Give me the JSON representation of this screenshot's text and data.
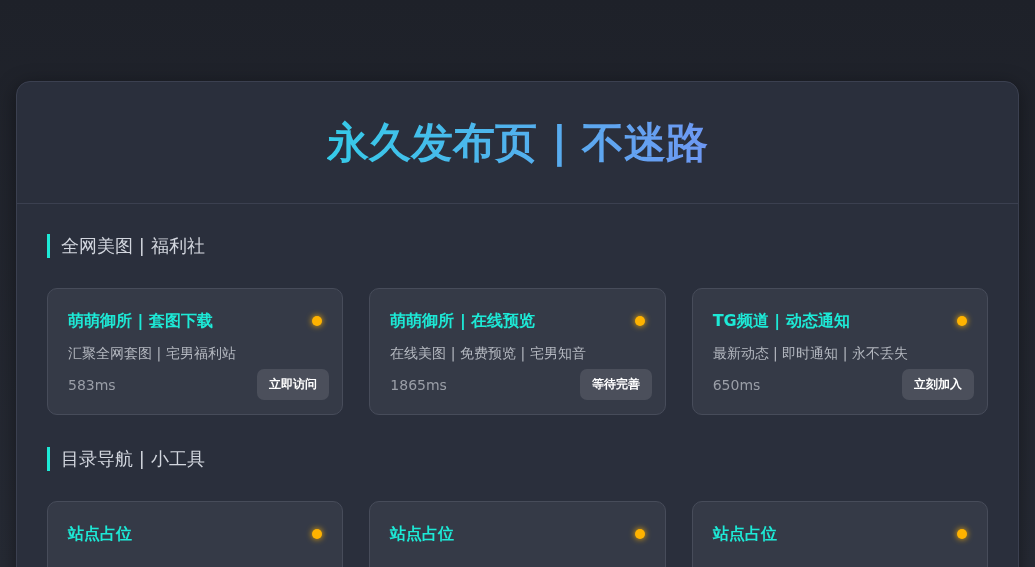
{
  "header": {
    "title": "永久发布页 | 不迷路"
  },
  "sections": [
    {
      "heading": "全网美图 | 福利社",
      "cards": [
        {
          "title": "萌萌御所 | 套图下载",
          "color": "#ffb300",
          "description": "汇聚全网套图 | 宅男福利站",
          "latency": "583ms",
          "button": "立即访问"
        },
        {
          "title": "萌萌御所 | 在线预览",
          "color": "#ffb300",
          "description": "在线美图 | 免费预览 | 宅男知音",
          "latency": "1865ms",
          "button": "等待完善"
        },
        {
          "title": "TG频道 | 动态通知",
          "color": "#ffb300",
          "description": "最新动态 | 即时通知 | 永不丢失",
          "latency": "650ms",
          "button": "立刻加入"
        }
      ]
    },
    {
      "heading": "目录导航 | 小工具",
      "cards": [
        {
          "title": "站点占位",
          "color": "#ffb300"
        },
        {
          "title": "站点占位",
          "color": "#ffb300"
        },
        {
          "title": "站点占位",
          "color": "#ffb300"
        }
      ]
    }
  ]
}
